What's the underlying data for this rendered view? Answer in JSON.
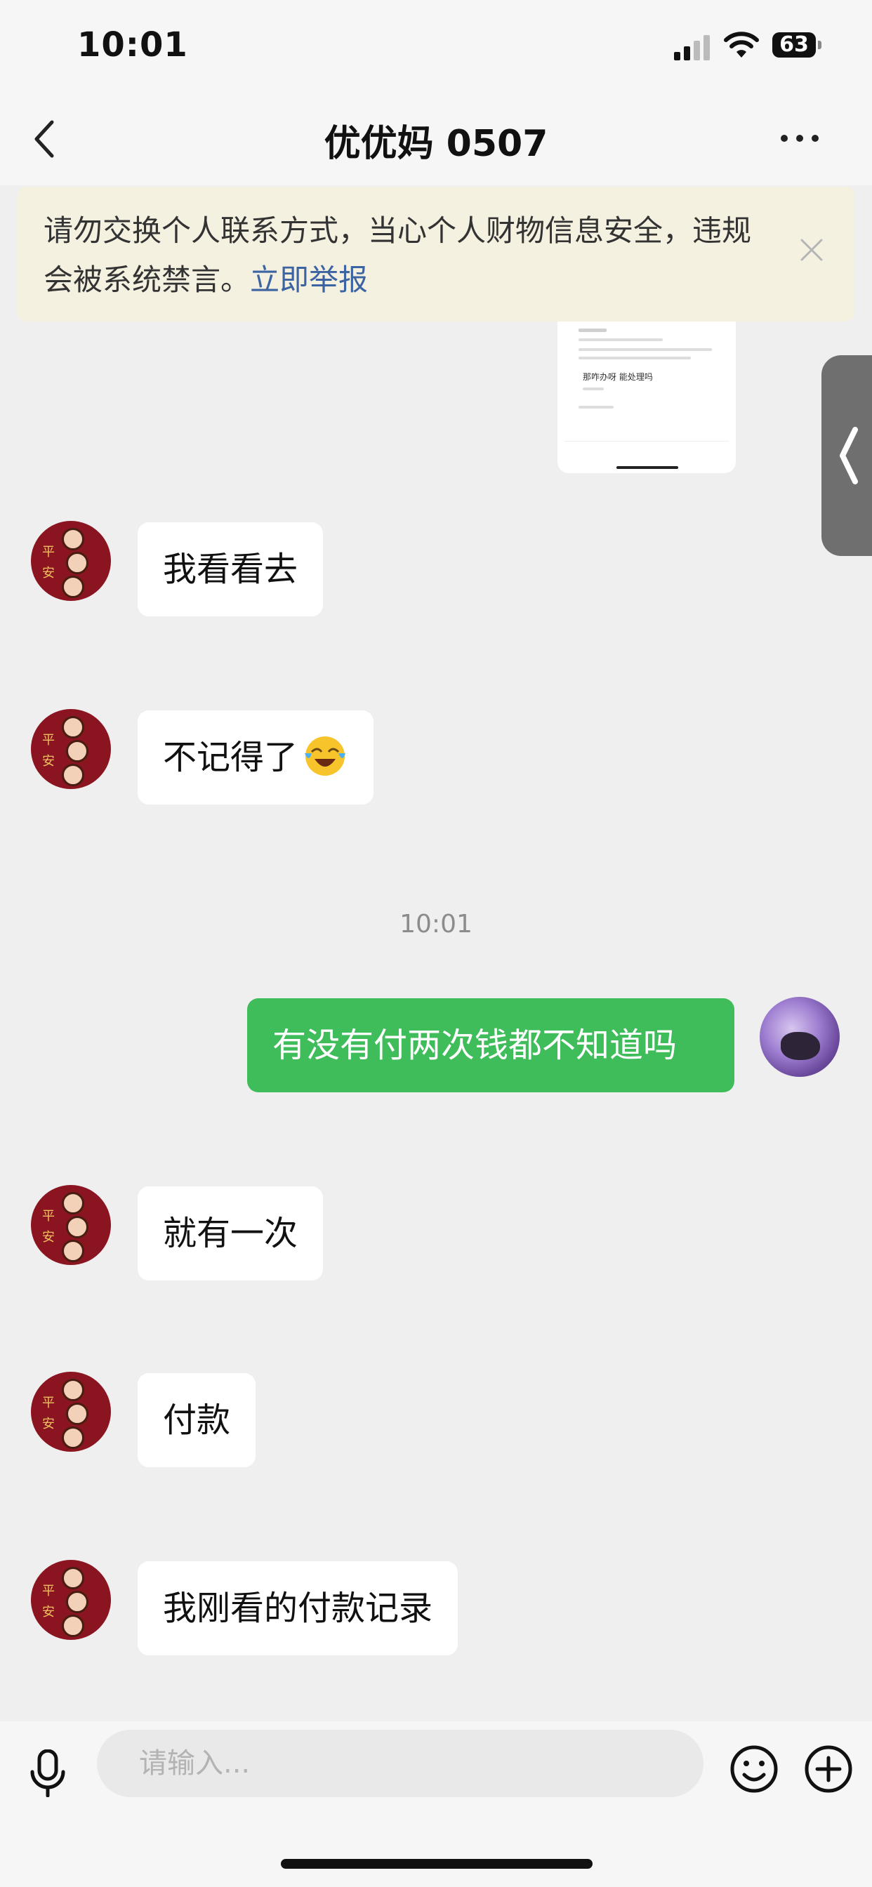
{
  "status_bar": {
    "time": "10:01",
    "battery": "63"
  },
  "header": {
    "title": "优优妈 0507"
  },
  "notice": {
    "text": "请勿交换个人联系方式，当心个人财物信息安全，违规会被系统禁言。",
    "link": "立即举报"
  },
  "image_message": {
    "title": "那咋办呀 能处理吗"
  },
  "messages": [
    {
      "sender": "other",
      "text": "我看看去"
    },
    {
      "sender": "other",
      "text": "不记得了",
      "emoji": "crying-laughing-emoji"
    },
    {
      "sender": "me",
      "text": "有没有付两次钱都不知道吗"
    },
    {
      "sender": "other",
      "text": "就有一次"
    },
    {
      "sender": "other",
      "text": "付款"
    },
    {
      "sender": "other",
      "text": "我刚看的付款记录"
    }
  ],
  "timestamp": "10:01",
  "input": {
    "placeholder": "请输入..."
  },
  "colors": {
    "outgoing_bubble": "#3fbd5a",
    "link": "#3d64a2",
    "notice_bg": "#f5f1e1"
  }
}
